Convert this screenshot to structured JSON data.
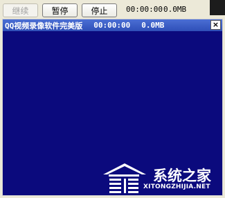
{
  "toolbar": {
    "continue_label": "继续",
    "pause_label": "暂停",
    "stop_label": "停止",
    "time": "00:00:00",
    "size": "0.0MB"
  },
  "preview_window": {
    "title": "QQ视频录像软件完美版",
    "time": "00:00:00",
    "size": "0.0MB",
    "close_glyph": "×",
    "background_color": "#0b0a7d"
  },
  "watermark": {
    "text": "系统之家",
    "url": "XITONGZHIJIA.NET"
  }
}
